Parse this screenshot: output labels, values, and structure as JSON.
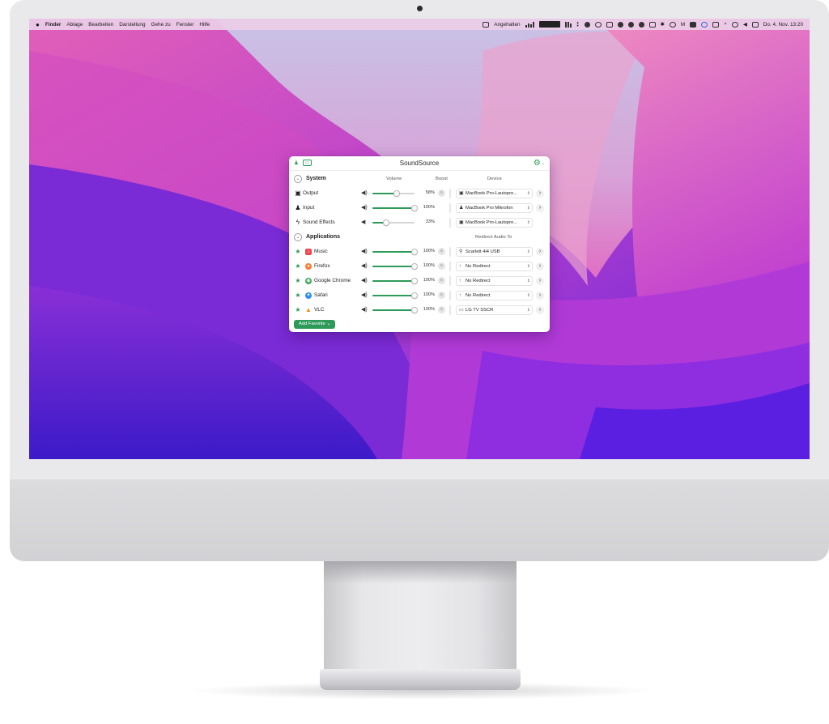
{
  "menubar": {
    "apple": "",
    "app_name": "Finder",
    "menus": [
      "Ablage",
      "Bearbeiten",
      "Darstellung",
      "Gehe zu",
      "Fenster",
      "Hilfe"
    ],
    "status_text": "Angehalten",
    "datetime": "Do. 4. Nov. 13:20"
  },
  "window": {
    "title": "SoundSource",
    "system_section": {
      "title": "System",
      "col_volume": "Volume",
      "col_boost": "Boost",
      "col_device": "Device",
      "rows": [
        {
          "label": "Output",
          "icon": "speaker-icon",
          "volume": 0.58,
          "pct": "58%",
          "device": "MacBook Pro-Lautspre...",
          "has_arrow": true
        },
        {
          "label": "Input",
          "icon": "microphone-icon",
          "volume": 1.0,
          "pct": "100%",
          "device": "MacBook Pro Mikrofon",
          "has_arrow": true
        },
        {
          "label": "Sound Effects",
          "icon": "bolt-icon",
          "volume": 0.33,
          "pct": "33%",
          "device": "MacBook Pro-Lautspre...",
          "has_arrow": false
        }
      ]
    },
    "apps_section": {
      "title": "Applications",
      "col_redirect": "Redirect Audio To",
      "rows": [
        {
          "label": "Music",
          "color": "#f2434f",
          "volume": 1.0,
          "pct": "100%",
          "device": "Scarlett 4i4 USB"
        },
        {
          "label": "Firefox",
          "color": "#ff7a2e",
          "volume": 1.0,
          "pct": "100%",
          "device": "No Redirect"
        },
        {
          "label": "Google Chrome",
          "color": "#3aa657",
          "volume": 1.0,
          "pct": "100%",
          "device": "No Redirect"
        },
        {
          "label": "Safari",
          "color": "#2f8df0",
          "volume": 1.0,
          "pct": "100%",
          "device": "No Redirect"
        },
        {
          "label": "VLC",
          "color": "#f28a1d",
          "volume": 1.0,
          "pct": "100%",
          "device": "LG TV SSCR"
        }
      ]
    },
    "add_favorite": "Add Favorite"
  },
  "colors": {
    "accent": "#2e9a5a",
    "menubar": "#ecc6e8"
  }
}
